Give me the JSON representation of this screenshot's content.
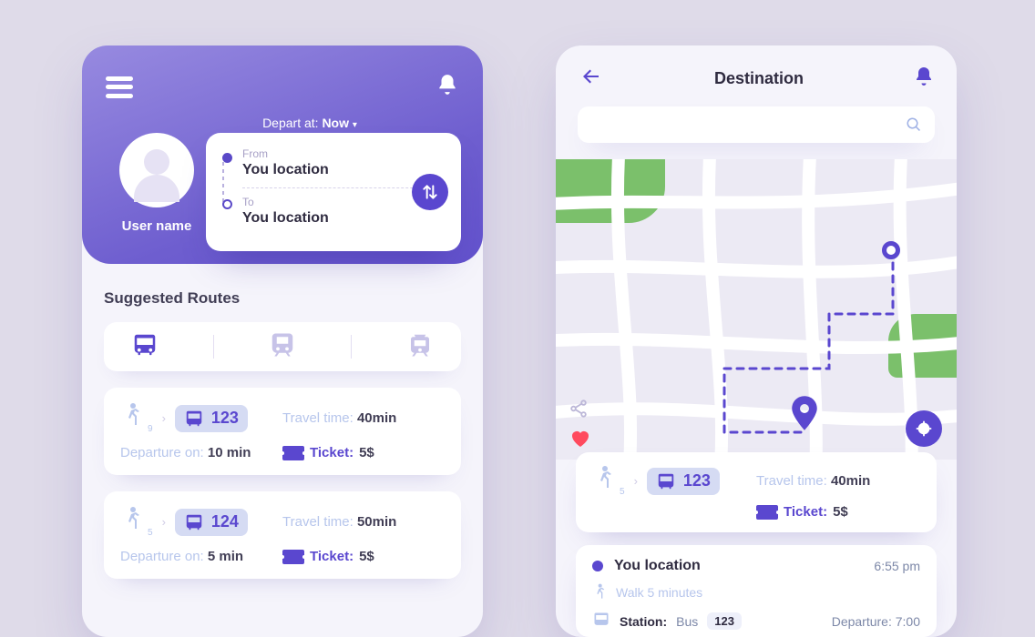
{
  "left": {
    "depart_label": "Depart at:",
    "depart_value": "Now",
    "user_name": "User name",
    "from_label": "From",
    "from_value": "You location",
    "to_label": "To",
    "to_value": "You location",
    "section_title": "Suggested Routes",
    "routes": [
      {
        "walk_mins": "9",
        "bus": "123",
        "travel_label": "Travel time:",
        "travel": "40min",
        "dep_label": "Departure on:",
        "dep": "10 min",
        "ticket_label": "Ticket:",
        "ticket": "5$"
      },
      {
        "walk_mins": "5",
        "bus": "124",
        "travel_label": "Travel time:",
        "travel": "50min",
        "dep_label": "Departure on:",
        "dep": "5 min",
        "ticket_label": "Ticket:",
        "ticket": "5$"
      }
    ]
  },
  "right": {
    "title": "Destination",
    "card": {
      "walk_mins": "5",
      "bus": "123",
      "travel_label": "Travel time:",
      "travel": "40min",
      "ticket_label": "Ticket:",
      "ticket": "5$"
    },
    "journey": {
      "loc_name": "You location",
      "loc_time": "6:55 pm",
      "walk_text": "Walk 5 minutes",
      "station_label": "Station:",
      "station_mode": "Bus",
      "station_bus": "123",
      "station_dep_label": "Departure:",
      "station_dep": "7:00"
    }
  }
}
